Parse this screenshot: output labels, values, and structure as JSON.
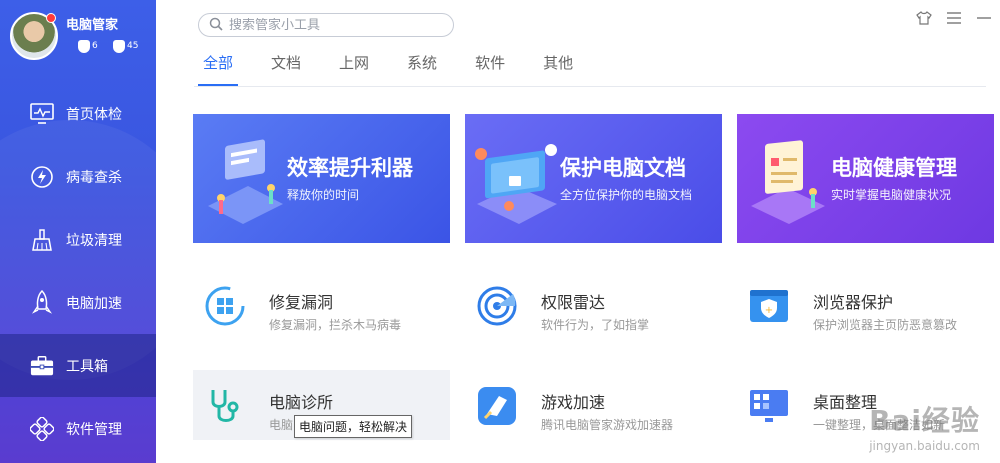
{
  "profile": {
    "name": "电脑管家",
    "badge1": "6",
    "badge2": "45"
  },
  "nav": [
    {
      "label": "首页体检",
      "icon": "monitor-icon"
    },
    {
      "label": "病毒查杀",
      "icon": "lightning-shield-icon"
    },
    {
      "label": "垃圾清理",
      "icon": "broom-icon"
    },
    {
      "label": "电脑加速",
      "icon": "rocket-icon"
    },
    {
      "label": "工具箱",
      "icon": "toolbox-icon",
      "active": true
    },
    {
      "label": "软件管理",
      "icon": "apps-icon"
    }
  ],
  "search": {
    "placeholder": "搜索管家小工具"
  },
  "tabs": [
    "全部",
    "文档",
    "上网",
    "系统",
    "软件",
    "其他"
  ],
  "banners": [
    {
      "title": "效率提升利器",
      "sub": "释放你的时间"
    },
    {
      "title": "保护电脑文档",
      "sub": "全方位保护你的电脑文档"
    },
    {
      "title": "电脑健康管理",
      "sub": "实时掌握电脑健康状况"
    }
  ],
  "tools": [
    {
      "name": "修复漏洞",
      "desc": "修复漏洞，拦杀木马病毒",
      "icon": "windows-repair-icon"
    },
    {
      "name": "权限雷达",
      "desc": "软件行为，了如指掌",
      "icon": "radar-icon"
    },
    {
      "name": "浏览器保护",
      "desc": "保护浏览器主页防恶意篡改",
      "icon": "browser-shield-icon"
    },
    {
      "name": "电脑诊所",
      "desc": "电脑问题，轻松解决",
      "icon": "stethoscope-icon"
    },
    {
      "name": "游戏加速",
      "desc": "腾讯电脑管家游戏加速器",
      "icon": "game-accelerate-icon"
    },
    {
      "name": "桌面整理",
      "desc": "一键整理，桌面整洁如新",
      "icon": "desktop-organize-icon"
    }
  ],
  "tooltip": "电脑问题，轻松解决",
  "watermark": {
    "main": "Bai经验",
    "sub": "jingyan.baidu.com"
  },
  "colors": {
    "accent": "#2a6ef5",
    "sidebar": "#3d5fe8"
  }
}
